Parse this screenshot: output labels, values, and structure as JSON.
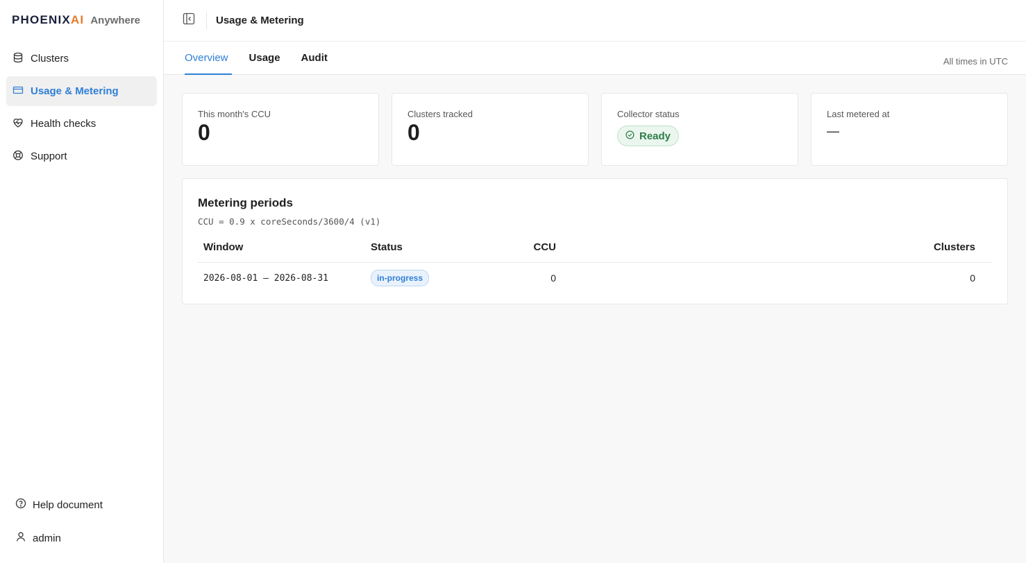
{
  "brand": {
    "mark_main": "PHOENIX",
    "mark_accent": "AI",
    "sub": "Anywhere"
  },
  "sidebar": {
    "items": [
      {
        "label": "Clusters",
        "icon": "database-icon",
        "active": false
      },
      {
        "label": "Usage & Metering",
        "icon": "credit-card-icon",
        "active": true
      },
      {
        "label": "Health checks",
        "icon": "heart-pulse-icon",
        "active": false
      },
      {
        "label": "Support",
        "icon": "lifebuoy-icon",
        "active": false
      }
    ],
    "bottom": [
      {
        "label": "Help document",
        "icon": "help-circle-icon"
      },
      {
        "label": "admin",
        "icon": "user-icon"
      }
    ]
  },
  "header": {
    "title": "Usage & Metering"
  },
  "tabs": [
    {
      "label": "Overview",
      "active": true
    },
    {
      "label": "Usage",
      "active": false
    },
    {
      "label": "Audit",
      "active": false
    }
  ],
  "timezone_note": "All times in UTC",
  "cards": {
    "ccu": {
      "label": "This month's CCU",
      "value": "0"
    },
    "clusters": {
      "label": "Clusters tracked",
      "value": "0"
    },
    "collector": {
      "label": "Collector status",
      "value": "Ready"
    },
    "last_metered": {
      "label": "Last metered at",
      "value": "—"
    }
  },
  "metering": {
    "title": "Metering periods",
    "formula": "CCU = 0.9 x coreSeconds/3600/4 (v1)",
    "columns": {
      "window": "Window",
      "status": "Status",
      "ccu": "CCU",
      "clusters": "Clusters"
    },
    "rows": [
      {
        "window": "2026-08-01 — 2026-08-31",
        "status": "in-progress",
        "ccu": "0",
        "clusters": "0"
      }
    ]
  },
  "colors": {
    "accent": "#2f7fd6",
    "brand_accent": "#e8792b",
    "ready": "#2e7d4a"
  }
}
